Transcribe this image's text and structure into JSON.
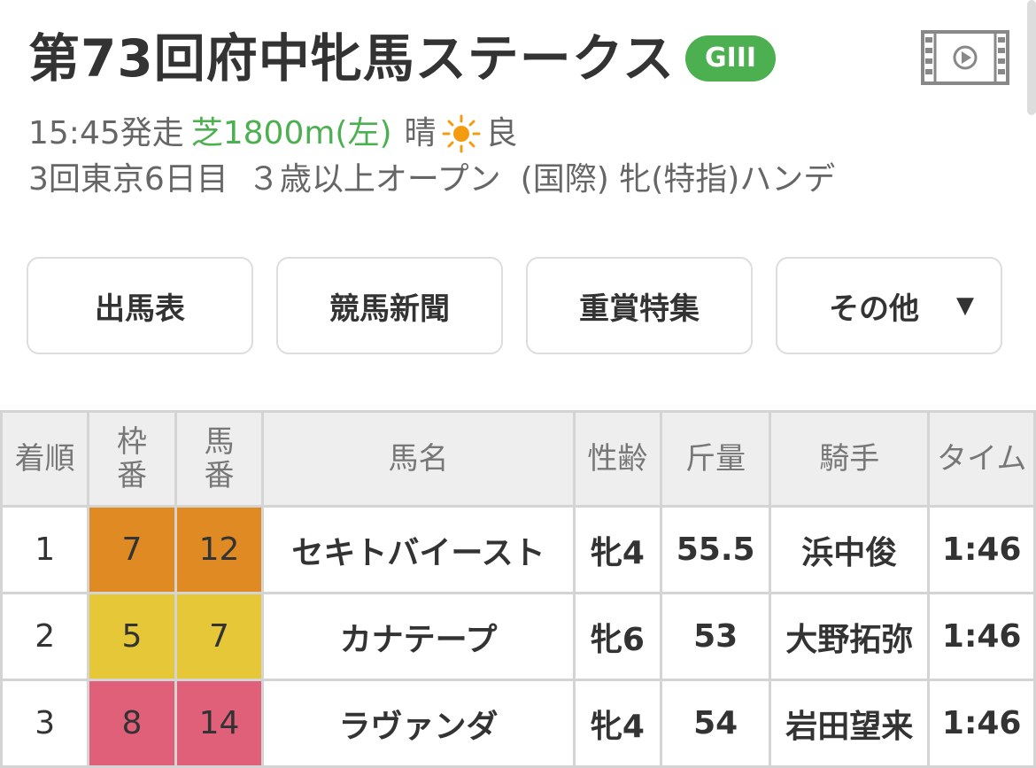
{
  "race": {
    "title": "第73回府中牝馬ステークス",
    "grade": "GIII",
    "start_time": "15:45発走",
    "course": "芝1800m(左)",
    "weather": "晴",
    "track_condition": "良",
    "meeting": "3回東京6日目",
    "class": "３歳以上オープン",
    "conditions": "(国際) 牝(特指)ハンデ"
  },
  "icons": {
    "video": "video-film-icon",
    "weather": "sun-icon"
  },
  "nav": [
    {
      "label": "出馬表"
    },
    {
      "label": "競馬新聞"
    },
    {
      "label": "重賞特集"
    },
    {
      "label": "その他",
      "caret": "▼"
    }
  ],
  "table": {
    "headers": {
      "rank": "着順",
      "waku": "枠番",
      "umaban": "馬番",
      "horse": "馬名",
      "sexage": "性齢",
      "weight": "斤量",
      "jockey": "騎手",
      "time": "タイム"
    },
    "rows": [
      {
        "rank": "1",
        "waku": "7",
        "umaban": "12",
        "horse": "セキトバイースト",
        "sexage": "牝4",
        "weight": "55.5",
        "jockey": "浜中俊",
        "time": "1:46",
        "color": "#e08a24"
      },
      {
        "rank": "2",
        "waku": "5",
        "umaban": "7",
        "horse": "カナテープ",
        "sexage": "牝6",
        "weight": "53",
        "jockey": "大野拓弥",
        "time": "1:46",
        "color": "#e6c737"
      },
      {
        "rank": "3",
        "waku": "8",
        "umaban": "14",
        "horse": "ラヴァンダ",
        "sexage": "牝4",
        "weight": "54",
        "jockey": "岩田望来",
        "time": "1:46",
        "color": "#e0607a"
      }
    ]
  },
  "colors": {
    "grade_badge": "#4caf50",
    "course": "#4caf50",
    "link": "#1a3e9c"
  }
}
